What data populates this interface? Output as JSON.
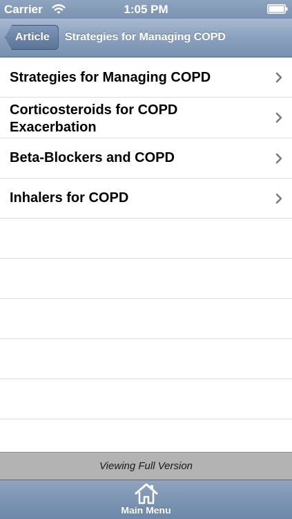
{
  "status_bar": {
    "carrier": "Carrier",
    "time": "1:05 PM",
    "wifi_icon": "wifi-icon",
    "battery_icon": "battery-icon"
  },
  "nav_bar": {
    "back_label": "Article",
    "title": "Strategies for Managing COPD"
  },
  "list": {
    "items": [
      {
        "label": "Strategies for Managing COPD",
        "icon": "chevron-right-icon"
      },
      {
        "label": "Corticosteroids for COPD Exacerbation",
        "icon": "chevron-right-icon"
      },
      {
        "label": "Beta-Blockers and COPD",
        "icon": "chevron-right-icon"
      },
      {
        "label": "Inhalers for COPD",
        "icon": "chevron-right-icon"
      }
    ]
  },
  "footer": {
    "text": "Viewing Full Version"
  },
  "tab_bar": {
    "main_menu_label": "Main Menu",
    "main_menu_icon": "home-icon"
  }
}
